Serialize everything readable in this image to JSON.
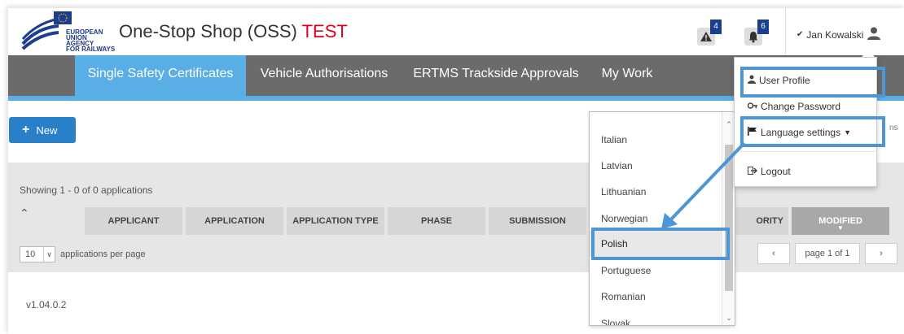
{
  "header": {
    "logo_lines": [
      "EUROPEAN",
      "UNION",
      "AGENCY",
      "FOR RAILWAYS"
    ],
    "title": "One-Stop Shop (OSS)",
    "title_env": "TEST",
    "alerts_count": "4",
    "notifications_count": "6",
    "user_name": "Jan Kowalski"
  },
  "nav": {
    "items": [
      {
        "label": "Single Safety Certificates"
      },
      {
        "label": "Vehicle Authorisations"
      },
      {
        "label": "ERTMS Trackside Approvals"
      },
      {
        "label": "My Work"
      }
    ]
  },
  "toolbar": {
    "new_label": "New",
    "search_hint": "ns"
  },
  "table": {
    "showing": "Showing 1 - 0 of 0 applications",
    "columns": [
      "APPLICANT",
      "APPLICATION",
      "APPLICATION TYPE",
      "PHASE",
      "SUBMISSION",
      "",
      "ORITY",
      "MODIFIED"
    ],
    "per_page_value": "10",
    "per_page_label": "applications per page",
    "pager_prev": "‹",
    "pager_text": "page 1 of 1",
    "pager_next": "›"
  },
  "version": "v1.04.0.2",
  "language_list": {
    "items": [
      "Italian",
      "Latvian",
      "Lithuanian",
      "Norwegian",
      "Polish",
      "Portuguese",
      "Romanian",
      "Slovak"
    ],
    "selected": "Polish"
  },
  "user_menu": {
    "profile": "User Profile",
    "change_password": "Change Password",
    "language_settings": "Language settings",
    "logout": "Logout"
  },
  "colors": {
    "nav_bg": "#6b6b6b",
    "accent": "#5aaee6",
    "highlight": "#4c96d6",
    "badge": "#1b3f8c",
    "test_red": "#e0001b"
  }
}
